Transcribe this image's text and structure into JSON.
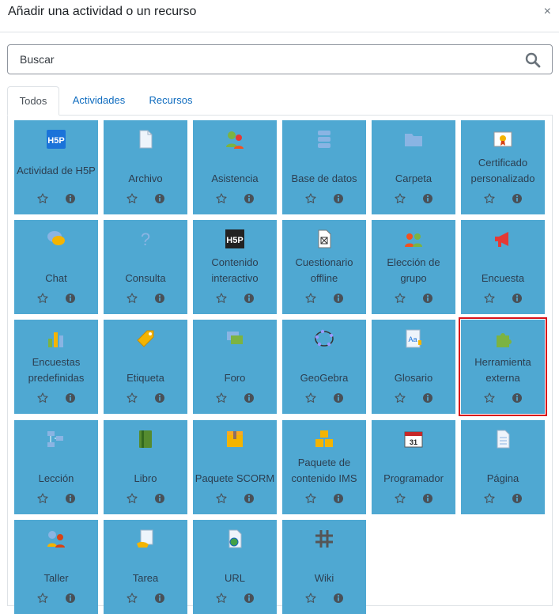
{
  "dialog": {
    "title": "Añadir una actividad o un recurso",
    "close": "×"
  },
  "search": {
    "placeholder": "Buscar"
  },
  "tabs": [
    {
      "label": "Todos",
      "active": true
    },
    {
      "label": "Actividades",
      "active": false
    },
    {
      "label": "Recursos",
      "active": false
    }
  ],
  "tiles": [
    {
      "label": "Actividad de H5P",
      "icon": "h5p-icon"
    },
    {
      "label": "Archivo",
      "icon": "file-icon"
    },
    {
      "label": "Asistencia",
      "icon": "attendance-icon"
    },
    {
      "label": "Base de datos",
      "icon": "database-icon"
    },
    {
      "label": "Carpeta",
      "icon": "folder-icon"
    },
    {
      "label": "Certificado personalizado",
      "icon": "certificate-icon"
    },
    {
      "label": "Chat",
      "icon": "chat-icon"
    },
    {
      "label": "Consulta",
      "icon": "question-icon"
    },
    {
      "label": "Contenido interactivo",
      "icon": "h5p-dark-icon"
    },
    {
      "label": "Cuestionario offline",
      "icon": "offline-quiz-icon"
    },
    {
      "label": "Elección de grupo",
      "icon": "group-choice-icon"
    },
    {
      "label": "Encuesta",
      "icon": "megaphone-icon"
    },
    {
      "label": "Encuestas predefinidas",
      "icon": "bar-chart-icon"
    },
    {
      "label": "Etiqueta",
      "icon": "label-tag-icon"
    },
    {
      "label": "Foro",
      "icon": "forum-icon"
    },
    {
      "label": "GeoGebra",
      "icon": "geogebra-icon"
    },
    {
      "label": "Glosario",
      "icon": "glossary-icon"
    },
    {
      "label": "Herramienta externa",
      "icon": "puzzle-icon",
      "selected": true
    },
    {
      "label": "Lección",
      "icon": "lesson-icon"
    },
    {
      "label": "Libro",
      "icon": "book-icon"
    },
    {
      "label": "Paquete SCORM",
      "icon": "scorm-package-icon"
    },
    {
      "label": "Paquete de contenido IMS",
      "icon": "ims-package-icon"
    },
    {
      "label": "Programador",
      "icon": "calendar-icon"
    },
    {
      "label": "Página",
      "icon": "page-icon"
    },
    {
      "label": "Taller",
      "icon": "workshop-icon"
    },
    {
      "label": "Tarea",
      "icon": "assignment-icon"
    },
    {
      "label": "URL",
      "icon": "url-icon"
    },
    {
      "label": "Wiki",
      "icon": "wiki-icon"
    }
  ],
  "colors": {
    "tile_bg": "#4fa8d2",
    "link": "#0f6cbf",
    "selected_outline": "#d9121a"
  }
}
